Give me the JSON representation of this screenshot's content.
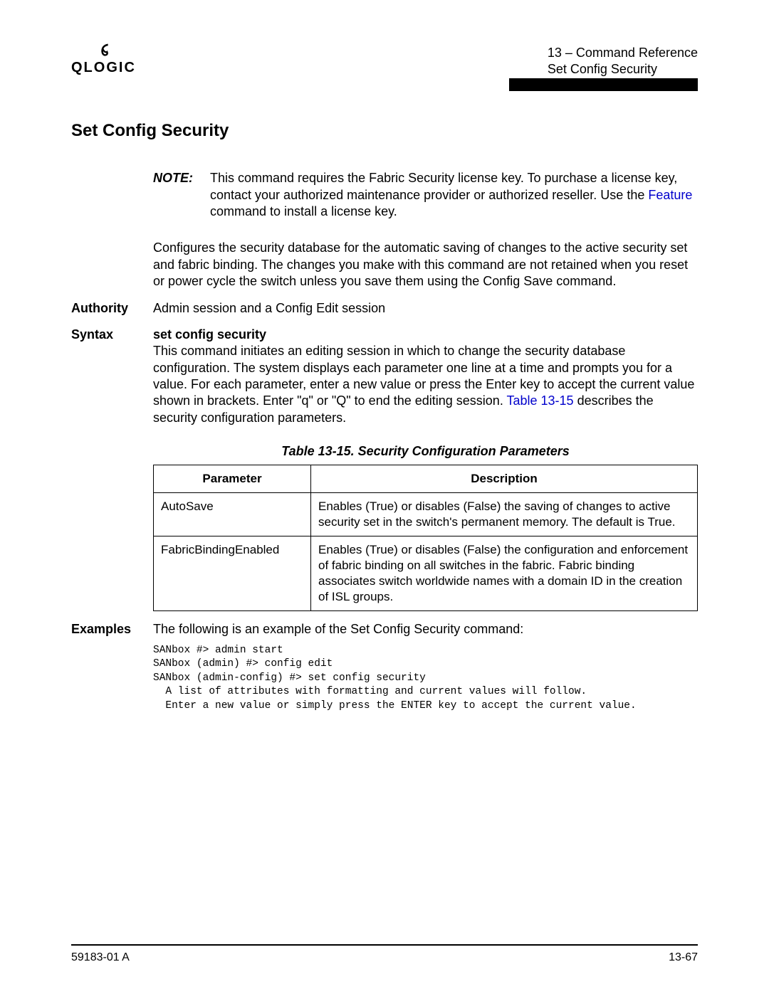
{
  "header": {
    "logo_text": "QLOGIC",
    "chapter_line": "13 – Command Reference",
    "page_line": "Set Config Security"
  },
  "title": "Set Config Security",
  "note": {
    "label": "NOTE:",
    "text_before_link": "This command requires the Fabric Security license key. To purchase a license key, contact your authorized maintenance provider or authorized reseller. Use the ",
    "link_text": "Feature",
    "text_after_link": " command to install a license key."
  },
  "description": "Configures the security database for the automatic saving of changes to the active security set and fabric binding. The changes you make with this command are not retained when you reset or power cycle the switch unless you save them using the Config Save command.",
  "authority": {
    "label": "Authority",
    "text": "Admin session and a Config Edit session"
  },
  "syntax": {
    "label": "Syntax",
    "sub": "set config security",
    "text_before_link": "This command initiates an editing session in which to change the security database configuration. The system displays each parameter one line at a time and prompts you for a value. For each parameter, enter a new value or press the Enter key to accept the current value shown in brackets. Enter \"q\" or \"Q\" to end the editing session. ",
    "link_text": "Table 13-15",
    "text_after_link": " describes the security configuration parameters."
  },
  "table": {
    "caption": "Table 13-15. Security Configuration Parameters",
    "headers": {
      "col1": "Parameter",
      "col2": "Description"
    },
    "rows": [
      {
        "param": "AutoSave",
        "desc": "Enables (True) or disables (False) the saving of changes to active security set in the switch's permanent memory. The default is True."
      },
      {
        "param": "FabricBindingEnabled",
        "desc": "Enables (True) or disables (False) the configuration and enforcement of fabric binding on all switches in the fabric. Fabric binding associates switch worldwide names with a domain ID in the creation of ISL groups."
      }
    ]
  },
  "examples": {
    "label": "Examples",
    "intro": "The following is an example of the Set Config Security command:",
    "code": "SANbox #> admin start\nSANbox (admin) #> config edit\nSANbox (admin-config) #> set config security\n  A list of attributes with formatting and current values will follow.\n  Enter a new value or simply press the ENTER key to accept the current value."
  },
  "footer": {
    "left": "59183-01 A",
    "right": "13-67"
  }
}
